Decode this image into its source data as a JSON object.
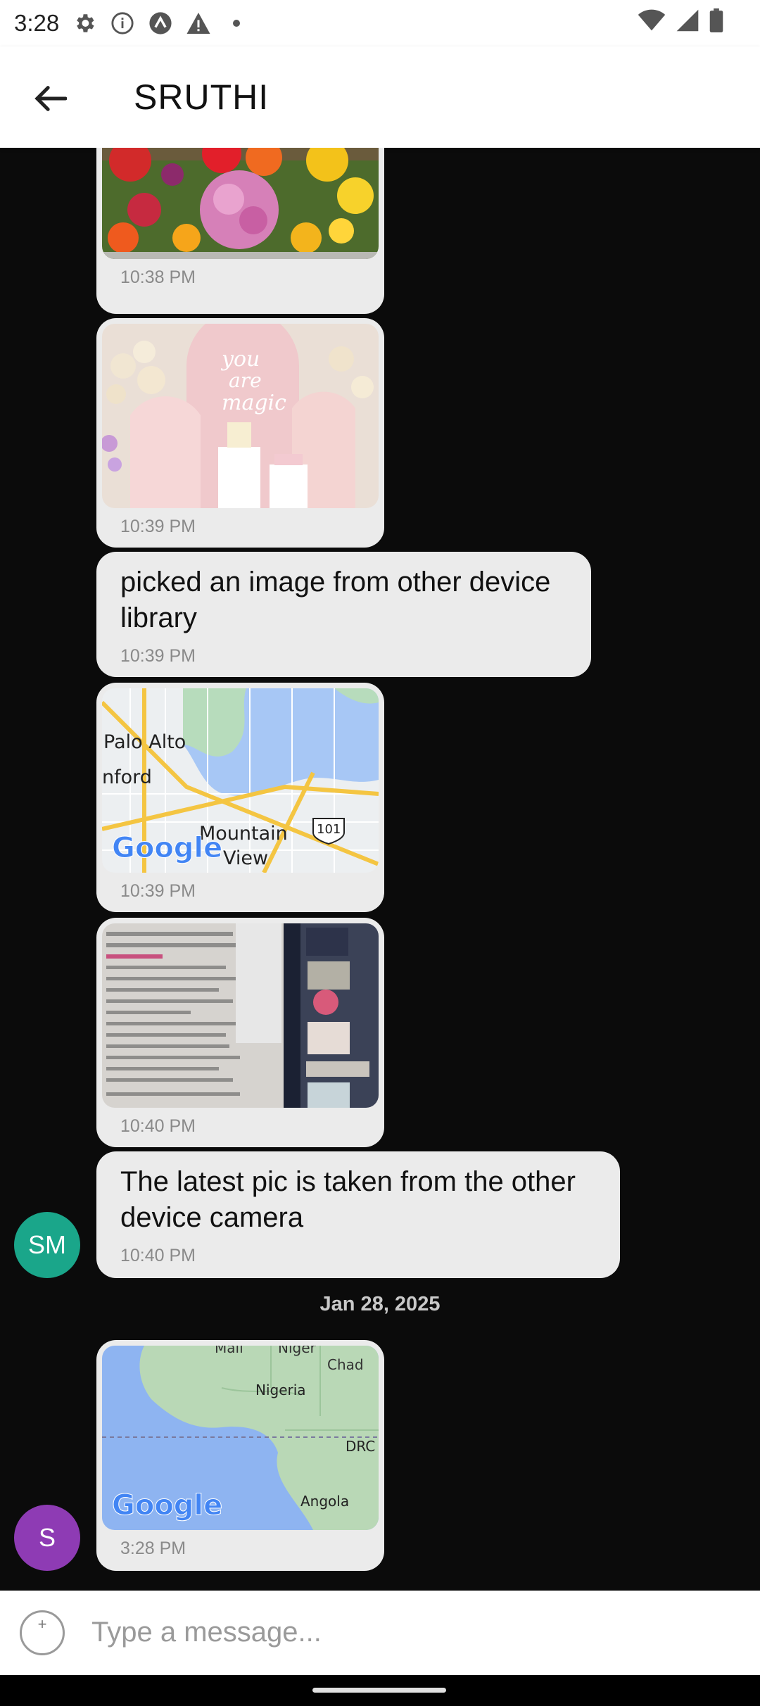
{
  "status": {
    "time": "3:28"
  },
  "header": {
    "title": "SRUTHI"
  },
  "messages": [
    {
      "type": "image",
      "image": "flower bouquet",
      "time": "10:38 PM"
    },
    {
      "type": "image",
      "image": "you are magic party decor",
      "time": "10:39 PM"
    },
    {
      "type": "text",
      "text": "picked an image from other device library",
      "time": "10:39 PM"
    },
    {
      "type": "image",
      "image": "map palo alto",
      "map_labels": [
        "Palo Alto",
        "nford",
        "Mountain",
        "View",
        "101",
        "Google"
      ],
      "time": "10:39 PM"
    },
    {
      "type": "image",
      "image": "screenshot photo",
      "time": "10:40 PM"
    },
    {
      "type": "text",
      "text": "The latest pic is taken from the other device camera",
      "time": "10:40 PM",
      "avatar": "SM"
    },
    {
      "type": "image",
      "image": "map africa",
      "map_labels": [
        "Mali",
        "Niger",
        "Chad",
        "Nigeria",
        "DRC",
        "Angola",
        "Google"
      ],
      "time": "3:28 PM",
      "avatar": "S"
    }
  ],
  "date_separator": "Jan 28, 2025",
  "composer": {
    "placeholder": "Type a message..."
  },
  "colors": {
    "avatar_sm": "#1aa68a",
    "avatar_s": "#8e3bb4",
    "bubble": "#ebebeb",
    "background": "#0b0b0b"
  }
}
